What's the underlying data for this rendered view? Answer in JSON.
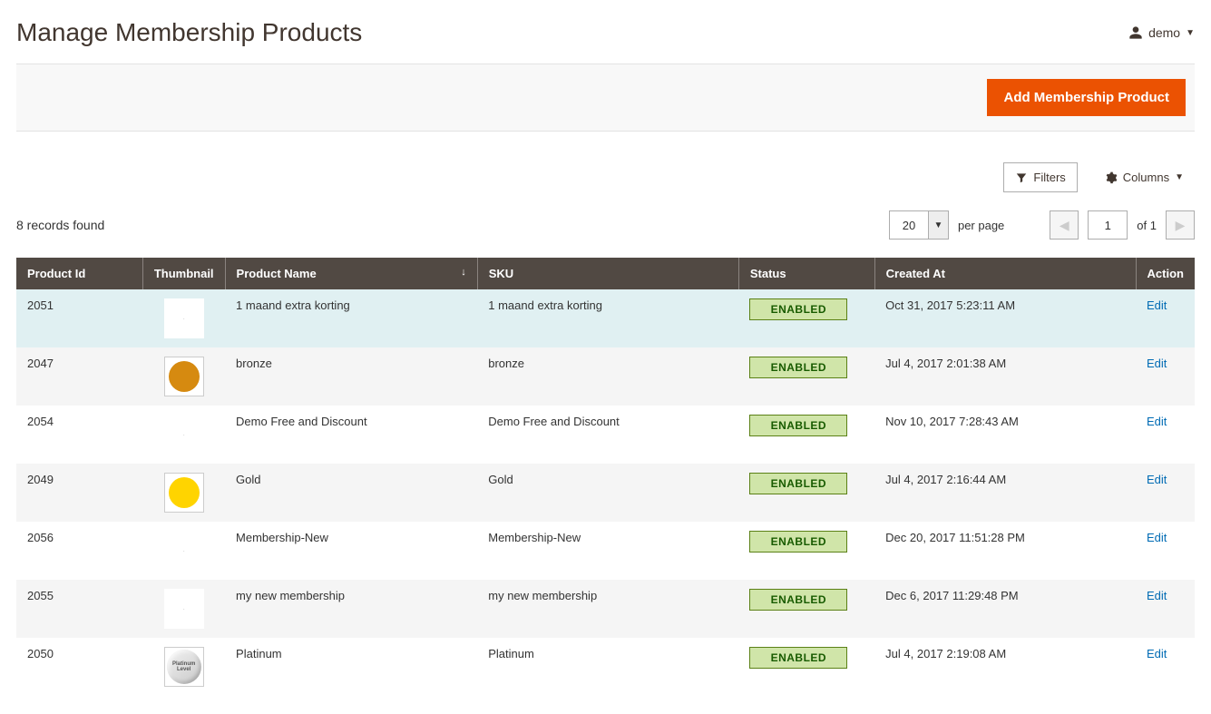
{
  "header": {
    "title": "Manage Membership Products",
    "user": "demo"
  },
  "actions": {
    "add_label": "Add Membership Product"
  },
  "toolbar": {
    "filters_label": "Filters",
    "columns_label": "Columns"
  },
  "grid": {
    "records_text": "8 records found",
    "page_size": "20",
    "per_page_label": "per page",
    "page": "1",
    "of_label": "of",
    "total_pages": "1",
    "columns": {
      "id": "Product Id",
      "thumb": "Thumbnail",
      "name": "Product Name",
      "sku": "SKU",
      "status": "Status",
      "created": "Created At",
      "action": "Action"
    },
    "edit_label": "Edit",
    "rows": [
      {
        "id": "2051",
        "thumb": "none",
        "name": "1 maand extra korting",
        "sku": "1 maand extra korting",
        "status": "ENABLED",
        "created": "Oct 31, 2017 5:23:11 AM",
        "selected": true
      },
      {
        "id": "2047",
        "thumb": "bronze",
        "name": "bronze",
        "sku": "bronze",
        "status": "ENABLED",
        "created": "Jul 4, 2017 2:01:38 AM"
      },
      {
        "id": "2054",
        "thumb": "none",
        "name": "Demo Free and Discount",
        "sku": "Demo Free and Discount",
        "status": "ENABLED",
        "created": "Nov 10, 2017 7:28:43 AM"
      },
      {
        "id": "2049",
        "thumb": "gold",
        "name": "Gold",
        "sku": "Gold",
        "status": "ENABLED",
        "created": "Jul 4, 2017 2:16:44 AM"
      },
      {
        "id": "2056",
        "thumb": "none",
        "name": "Membership-New",
        "sku": "Membership-New",
        "status": "ENABLED",
        "created": "Dec 20, 2017 11:51:28 PM"
      },
      {
        "id": "2055",
        "thumb": "none",
        "name": "my new membership",
        "sku": "my new membership",
        "status": "ENABLED",
        "created": "Dec 6, 2017 11:29:48 PM"
      },
      {
        "id": "2050",
        "thumb": "platinum",
        "name": "Platinum",
        "sku": "Platinum",
        "status": "ENABLED",
        "created": "Jul 4, 2017 2:19:08 AM"
      }
    ]
  },
  "colors": {
    "bronze": "#d68a10",
    "gold": "#ffd400"
  }
}
